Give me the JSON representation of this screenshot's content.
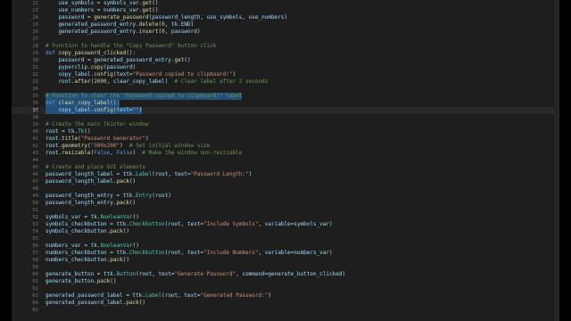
{
  "editor": {
    "first_line": 22,
    "current_line": 37,
    "selection_lines": [
      35,
      36,
      37
    ],
    "lines": [
      {
        "n": "22",
        "tokens": [
          [
            "v",
            "    use_symbols"
          ],
          [
            "p",
            " = "
          ],
          [
            "v",
            "symbols_var"
          ],
          [
            "p",
            "."
          ],
          [
            "f",
            "get"
          ],
          [
            "p",
            "()"
          ]
        ]
      },
      {
        "n": "23",
        "tokens": [
          [
            "v",
            "    use_numbers"
          ],
          [
            "p",
            " = "
          ],
          [
            "v",
            "numbers_var"
          ],
          [
            "p",
            "."
          ],
          [
            "f",
            "get"
          ],
          [
            "p",
            "()"
          ]
        ]
      },
      {
        "n": "24",
        "tokens": [
          [
            "v",
            "    password"
          ],
          [
            "p",
            " = "
          ],
          [
            "f",
            "generate_password"
          ],
          [
            "p",
            "("
          ],
          [
            "v",
            "password_length"
          ],
          [
            "p",
            ", "
          ],
          [
            "v",
            "use_symbols"
          ],
          [
            "p",
            ", "
          ],
          [
            "v",
            "use_numbers"
          ],
          [
            "p",
            ")"
          ]
        ]
      },
      {
        "n": "25",
        "tokens": [
          [
            "v",
            "    generated_password_entry"
          ],
          [
            "p",
            "."
          ],
          [
            "f",
            "delete"
          ],
          [
            "p",
            "("
          ],
          [
            "n",
            "0"
          ],
          [
            "p",
            ", "
          ],
          [
            "v",
            "tk"
          ],
          [
            "p",
            "."
          ],
          [
            "v",
            "END"
          ],
          [
            "p",
            ")"
          ]
        ]
      },
      {
        "n": "26",
        "tokens": [
          [
            "v",
            "    generated_password_entry"
          ],
          [
            "p",
            "."
          ],
          [
            "f",
            "insert"
          ],
          [
            "p",
            "("
          ],
          [
            "n",
            "0"
          ],
          [
            "p",
            ", "
          ],
          [
            "v",
            "password"
          ],
          [
            "p",
            ")"
          ]
        ]
      },
      {
        "n": "27",
        "tokens": []
      },
      {
        "n": "28",
        "tokens": [
          [
            "c",
            "# Function to handle the \"Copy Password\" button click"
          ]
        ]
      },
      {
        "n": "29",
        "tokens": [
          [
            "k",
            "def "
          ],
          [
            "f",
            "copy_password_clicked"
          ],
          [
            "p",
            "():"
          ]
        ]
      },
      {
        "n": "30",
        "tokens": [
          [
            "v",
            "    password"
          ],
          [
            "p",
            " = "
          ],
          [
            "v",
            "generated_password_entry"
          ],
          [
            "p",
            "."
          ],
          [
            "f",
            "get"
          ],
          [
            "p",
            "()"
          ]
        ]
      },
      {
        "n": "31",
        "tokens": [
          [
            "v",
            "    pyperclip"
          ],
          [
            "p",
            "."
          ],
          [
            "f",
            "copy"
          ],
          [
            "p",
            "("
          ],
          [
            "v",
            "password"
          ],
          [
            "p",
            ")"
          ]
        ]
      },
      {
        "n": "32",
        "tokens": [
          [
            "v",
            "    copy_label"
          ],
          [
            "p",
            "."
          ],
          [
            "f",
            "config"
          ],
          [
            "p",
            "("
          ],
          [
            "v",
            "text"
          ],
          [
            "p",
            "="
          ],
          [
            "s",
            "\"Password copied to clipboard!\""
          ],
          [
            "p",
            ")"
          ]
        ]
      },
      {
        "n": "33",
        "tokens": [
          [
            "v",
            "    root"
          ],
          [
            "p",
            "."
          ],
          [
            "f",
            "after"
          ],
          [
            "p",
            "("
          ],
          [
            "n",
            "2000"
          ],
          [
            "p",
            ", "
          ],
          [
            "v",
            "clear_copy_label"
          ],
          [
            "p",
            ")  "
          ],
          [
            "c",
            "# Clear label after 2 seconds"
          ]
        ]
      },
      {
        "n": "34",
        "tokens": []
      },
      {
        "n": "35",
        "tokens": [
          [
            "c",
            "# Function to clear the \"Password copied to clipboard!\" label"
          ]
        ]
      },
      {
        "n": "36",
        "tokens": [
          [
            "k",
            "def "
          ],
          [
            "f",
            "clear_copy_label"
          ],
          [
            "p",
            "():"
          ]
        ]
      },
      {
        "n": "37",
        "tokens": [
          [
            "v",
            "    copy_label"
          ],
          [
            "p",
            "."
          ],
          [
            "f",
            "config"
          ],
          [
            "p",
            "("
          ],
          [
            "v",
            "text"
          ],
          [
            "p",
            "="
          ],
          [
            "s",
            "\"\""
          ],
          [
            "p",
            ")"
          ]
        ]
      },
      {
        "n": "38",
        "tokens": []
      },
      {
        "n": "39",
        "tokens": [
          [
            "c",
            "# Create the main Tkinter window"
          ]
        ]
      },
      {
        "n": "40",
        "tokens": [
          [
            "v",
            "root"
          ],
          [
            "p",
            " = "
          ],
          [
            "v",
            "tk"
          ],
          [
            "p",
            "."
          ],
          [
            "t",
            "Tk"
          ],
          [
            "p",
            "()"
          ]
        ]
      },
      {
        "n": "41",
        "tokens": [
          [
            "v",
            "root"
          ],
          [
            "p",
            "."
          ],
          [
            "f",
            "title"
          ],
          [
            "p",
            "("
          ],
          [
            "s",
            "\"Password Generator\""
          ],
          [
            "p",
            ")"
          ]
        ]
      },
      {
        "n": "42",
        "tokens": [
          [
            "v",
            "root"
          ],
          [
            "p",
            "."
          ],
          [
            "f",
            "geometry"
          ],
          [
            "p",
            "("
          ],
          [
            "s",
            "\"300x200\""
          ],
          [
            "p",
            ")  "
          ],
          [
            "c",
            "# Set initial window size"
          ]
        ]
      },
      {
        "n": "43",
        "tokens": [
          [
            "v",
            "root"
          ],
          [
            "p",
            "."
          ],
          [
            "f",
            "resizable"
          ],
          [
            "p",
            "("
          ],
          [
            "k",
            "False"
          ],
          [
            "p",
            ", "
          ],
          [
            "k",
            "False"
          ],
          [
            "p",
            ")  "
          ],
          [
            "c",
            "# Make the window non-resizable"
          ]
        ]
      },
      {
        "n": "44",
        "tokens": []
      },
      {
        "n": "45",
        "tokens": [
          [
            "c",
            "# Create and place GUI elements"
          ]
        ]
      },
      {
        "n": "46",
        "tokens": [
          [
            "v",
            "password_length_label"
          ],
          [
            "p",
            " = "
          ],
          [
            "v",
            "ttk"
          ],
          [
            "p",
            "."
          ],
          [
            "t",
            "Label"
          ],
          [
            "p",
            "("
          ],
          [
            "v",
            "root"
          ],
          [
            "p",
            ", "
          ],
          [
            "v",
            "text"
          ],
          [
            "p",
            "="
          ],
          [
            "s",
            "\"Password Length:\""
          ],
          [
            "p",
            ")"
          ]
        ]
      },
      {
        "n": "47",
        "tokens": [
          [
            "v",
            "password_length_label"
          ],
          [
            "p",
            "."
          ],
          [
            "f",
            "pack"
          ],
          [
            "p",
            "()"
          ]
        ]
      },
      {
        "n": "48",
        "tokens": []
      },
      {
        "n": "49",
        "tokens": [
          [
            "v",
            "password_length_entry"
          ],
          [
            "p",
            " = "
          ],
          [
            "v",
            "ttk"
          ],
          [
            "p",
            "."
          ],
          [
            "t",
            "Entry"
          ],
          [
            "p",
            "("
          ],
          [
            "v",
            "root"
          ],
          [
            "p",
            ")"
          ]
        ]
      },
      {
        "n": "50",
        "tokens": [
          [
            "v",
            "password_length_entry"
          ],
          [
            "p",
            "."
          ],
          [
            "f",
            "pack"
          ],
          [
            "p",
            "()"
          ]
        ]
      },
      {
        "n": "51",
        "tokens": []
      },
      {
        "n": "52",
        "tokens": [
          [
            "v",
            "symbols_var"
          ],
          [
            "p",
            " = "
          ],
          [
            "v",
            "tk"
          ],
          [
            "p",
            "."
          ],
          [
            "t",
            "BooleanVar"
          ],
          [
            "p",
            "()"
          ]
        ]
      },
      {
        "n": "53",
        "tokens": [
          [
            "v",
            "symbols_checkbutton"
          ],
          [
            "p",
            " = "
          ],
          [
            "v",
            "ttk"
          ],
          [
            "p",
            "."
          ],
          [
            "t",
            "Checkbutton"
          ],
          [
            "p",
            "("
          ],
          [
            "v",
            "root"
          ],
          [
            "p",
            ", "
          ],
          [
            "v",
            "text"
          ],
          [
            "p",
            "="
          ],
          [
            "s",
            "\"Include Symbols\""
          ],
          [
            "p",
            ", "
          ],
          [
            "v",
            "variable"
          ],
          [
            "p",
            "="
          ],
          [
            "v",
            "symbols_var"
          ],
          [
            "p",
            ")"
          ]
        ]
      },
      {
        "n": "54",
        "tokens": [
          [
            "v",
            "symbols_checkbutton"
          ],
          [
            "p",
            "."
          ],
          [
            "f",
            "pack"
          ],
          [
            "p",
            "()"
          ]
        ]
      },
      {
        "n": "55",
        "tokens": []
      },
      {
        "n": "56",
        "tokens": [
          [
            "v",
            "numbers_var"
          ],
          [
            "p",
            " = "
          ],
          [
            "v",
            "tk"
          ],
          [
            "p",
            "."
          ],
          [
            "t",
            "BooleanVar"
          ],
          [
            "p",
            "()"
          ]
        ]
      },
      {
        "n": "57",
        "tokens": [
          [
            "v",
            "numbers_checkbutton"
          ],
          [
            "p",
            " = "
          ],
          [
            "v",
            "ttk"
          ],
          [
            "p",
            "."
          ],
          [
            "t",
            "Checkbutton"
          ],
          [
            "p",
            "("
          ],
          [
            "v",
            "root"
          ],
          [
            "p",
            ", "
          ],
          [
            "v",
            "text"
          ],
          [
            "p",
            "="
          ],
          [
            "s",
            "\"Include Numbers\""
          ],
          [
            "p",
            ", "
          ],
          [
            "v",
            "variable"
          ],
          [
            "p",
            "="
          ],
          [
            "v",
            "numbers_var"
          ],
          [
            "p",
            ")"
          ]
        ]
      },
      {
        "n": "58",
        "tokens": [
          [
            "v",
            "numbers_checkbutton"
          ],
          [
            "p",
            "."
          ],
          [
            "f",
            "pack"
          ],
          [
            "p",
            "()"
          ]
        ]
      },
      {
        "n": "59",
        "tokens": []
      },
      {
        "n": "60",
        "tokens": [
          [
            "v",
            "generate_button"
          ],
          [
            "p",
            " = "
          ],
          [
            "v",
            "ttk"
          ],
          [
            "p",
            "."
          ],
          [
            "t",
            "Button"
          ],
          [
            "p",
            "("
          ],
          [
            "v",
            "root"
          ],
          [
            "p",
            ", "
          ],
          [
            "v",
            "text"
          ],
          [
            "p",
            "="
          ],
          [
            "s",
            "\"Generate Password\""
          ],
          [
            "p",
            ", "
          ],
          [
            "v",
            "command"
          ],
          [
            "p",
            "="
          ],
          [
            "v",
            "generate_button_clicked"
          ],
          [
            "p",
            ")"
          ]
        ]
      },
      {
        "n": "61",
        "tokens": [
          [
            "v",
            "generate_button"
          ],
          [
            "p",
            "."
          ],
          [
            "f",
            "pack"
          ],
          [
            "p",
            "()"
          ]
        ]
      },
      {
        "n": "62",
        "tokens": []
      },
      {
        "n": "63",
        "tokens": [
          [
            "v",
            "generated_password_label"
          ],
          [
            "p",
            " = "
          ],
          [
            "v",
            "ttk"
          ],
          [
            "p",
            "."
          ],
          [
            "t",
            "Label"
          ],
          [
            "p",
            "("
          ],
          [
            "v",
            "root"
          ],
          [
            "p",
            ", "
          ],
          [
            "v",
            "text"
          ],
          [
            "p",
            "="
          ],
          [
            "s",
            "\"Generated Password:\""
          ],
          [
            "p",
            ")"
          ]
        ]
      },
      {
        "n": "64",
        "tokens": [
          [
            "v",
            "generated_password_label"
          ],
          [
            "p",
            "."
          ],
          [
            "f",
            "pack"
          ],
          [
            "p",
            "()"
          ]
        ]
      },
      {
        "n": "65",
        "tokens": []
      }
    ]
  }
}
